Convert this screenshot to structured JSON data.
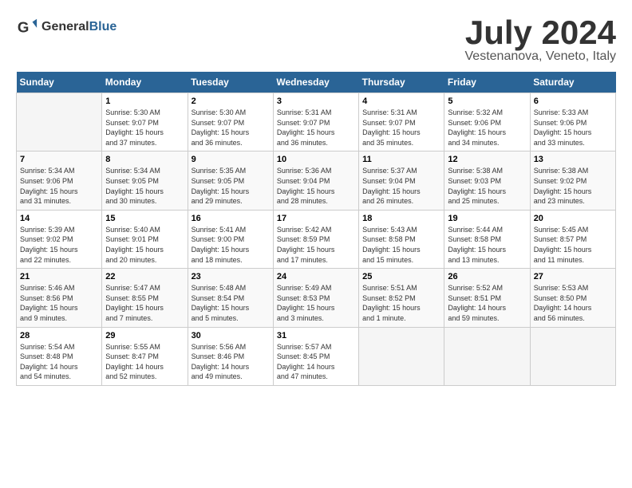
{
  "logo": {
    "general": "General",
    "blue": "Blue"
  },
  "title": "July 2024",
  "location": "Vestenanova, Veneto, Italy",
  "weekdays": [
    "Sunday",
    "Monday",
    "Tuesday",
    "Wednesday",
    "Thursday",
    "Friday",
    "Saturday"
  ],
  "weeks": [
    [
      {
        "date": "",
        "info": ""
      },
      {
        "date": "1",
        "info": "Sunrise: 5:30 AM\nSunset: 9:07 PM\nDaylight: 15 hours\nand 37 minutes."
      },
      {
        "date": "2",
        "info": "Sunrise: 5:30 AM\nSunset: 9:07 PM\nDaylight: 15 hours\nand 36 minutes."
      },
      {
        "date": "3",
        "info": "Sunrise: 5:31 AM\nSunset: 9:07 PM\nDaylight: 15 hours\nand 36 minutes."
      },
      {
        "date": "4",
        "info": "Sunrise: 5:31 AM\nSunset: 9:07 PM\nDaylight: 15 hours\nand 35 minutes."
      },
      {
        "date": "5",
        "info": "Sunrise: 5:32 AM\nSunset: 9:06 PM\nDaylight: 15 hours\nand 34 minutes."
      },
      {
        "date": "6",
        "info": "Sunrise: 5:33 AM\nSunset: 9:06 PM\nDaylight: 15 hours\nand 33 minutes."
      }
    ],
    [
      {
        "date": "7",
        "info": "Sunrise: 5:34 AM\nSunset: 9:06 PM\nDaylight: 15 hours\nand 31 minutes."
      },
      {
        "date": "8",
        "info": "Sunrise: 5:34 AM\nSunset: 9:05 PM\nDaylight: 15 hours\nand 30 minutes."
      },
      {
        "date": "9",
        "info": "Sunrise: 5:35 AM\nSunset: 9:05 PM\nDaylight: 15 hours\nand 29 minutes."
      },
      {
        "date": "10",
        "info": "Sunrise: 5:36 AM\nSunset: 9:04 PM\nDaylight: 15 hours\nand 28 minutes."
      },
      {
        "date": "11",
        "info": "Sunrise: 5:37 AM\nSunset: 9:04 PM\nDaylight: 15 hours\nand 26 minutes."
      },
      {
        "date": "12",
        "info": "Sunrise: 5:38 AM\nSunset: 9:03 PM\nDaylight: 15 hours\nand 25 minutes."
      },
      {
        "date": "13",
        "info": "Sunrise: 5:38 AM\nSunset: 9:02 PM\nDaylight: 15 hours\nand 23 minutes."
      }
    ],
    [
      {
        "date": "14",
        "info": "Sunrise: 5:39 AM\nSunset: 9:02 PM\nDaylight: 15 hours\nand 22 minutes."
      },
      {
        "date": "15",
        "info": "Sunrise: 5:40 AM\nSunset: 9:01 PM\nDaylight: 15 hours\nand 20 minutes."
      },
      {
        "date": "16",
        "info": "Sunrise: 5:41 AM\nSunset: 9:00 PM\nDaylight: 15 hours\nand 18 minutes."
      },
      {
        "date": "17",
        "info": "Sunrise: 5:42 AM\nSunset: 8:59 PM\nDaylight: 15 hours\nand 17 minutes."
      },
      {
        "date": "18",
        "info": "Sunrise: 5:43 AM\nSunset: 8:58 PM\nDaylight: 15 hours\nand 15 minutes."
      },
      {
        "date": "19",
        "info": "Sunrise: 5:44 AM\nSunset: 8:58 PM\nDaylight: 15 hours\nand 13 minutes."
      },
      {
        "date": "20",
        "info": "Sunrise: 5:45 AM\nSunset: 8:57 PM\nDaylight: 15 hours\nand 11 minutes."
      }
    ],
    [
      {
        "date": "21",
        "info": "Sunrise: 5:46 AM\nSunset: 8:56 PM\nDaylight: 15 hours\nand 9 minutes."
      },
      {
        "date": "22",
        "info": "Sunrise: 5:47 AM\nSunset: 8:55 PM\nDaylight: 15 hours\nand 7 minutes."
      },
      {
        "date": "23",
        "info": "Sunrise: 5:48 AM\nSunset: 8:54 PM\nDaylight: 15 hours\nand 5 minutes."
      },
      {
        "date": "24",
        "info": "Sunrise: 5:49 AM\nSunset: 8:53 PM\nDaylight: 15 hours\nand 3 minutes."
      },
      {
        "date": "25",
        "info": "Sunrise: 5:51 AM\nSunset: 8:52 PM\nDaylight: 15 hours\nand 1 minute."
      },
      {
        "date": "26",
        "info": "Sunrise: 5:52 AM\nSunset: 8:51 PM\nDaylight: 14 hours\nand 59 minutes."
      },
      {
        "date": "27",
        "info": "Sunrise: 5:53 AM\nSunset: 8:50 PM\nDaylight: 14 hours\nand 56 minutes."
      }
    ],
    [
      {
        "date": "28",
        "info": "Sunrise: 5:54 AM\nSunset: 8:48 PM\nDaylight: 14 hours\nand 54 minutes."
      },
      {
        "date": "29",
        "info": "Sunrise: 5:55 AM\nSunset: 8:47 PM\nDaylight: 14 hours\nand 52 minutes."
      },
      {
        "date": "30",
        "info": "Sunrise: 5:56 AM\nSunset: 8:46 PM\nDaylight: 14 hours\nand 49 minutes."
      },
      {
        "date": "31",
        "info": "Sunrise: 5:57 AM\nSunset: 8:45 PM\nDaylight: 14 hours\nand 47 minutes."
      },
      {
        "date": "",
        "info": ""
      },
      {
        "date": "",
        "info": ""
      },
      {
        "date": "",
        "info": ""
      }
    ]
  ]
}
